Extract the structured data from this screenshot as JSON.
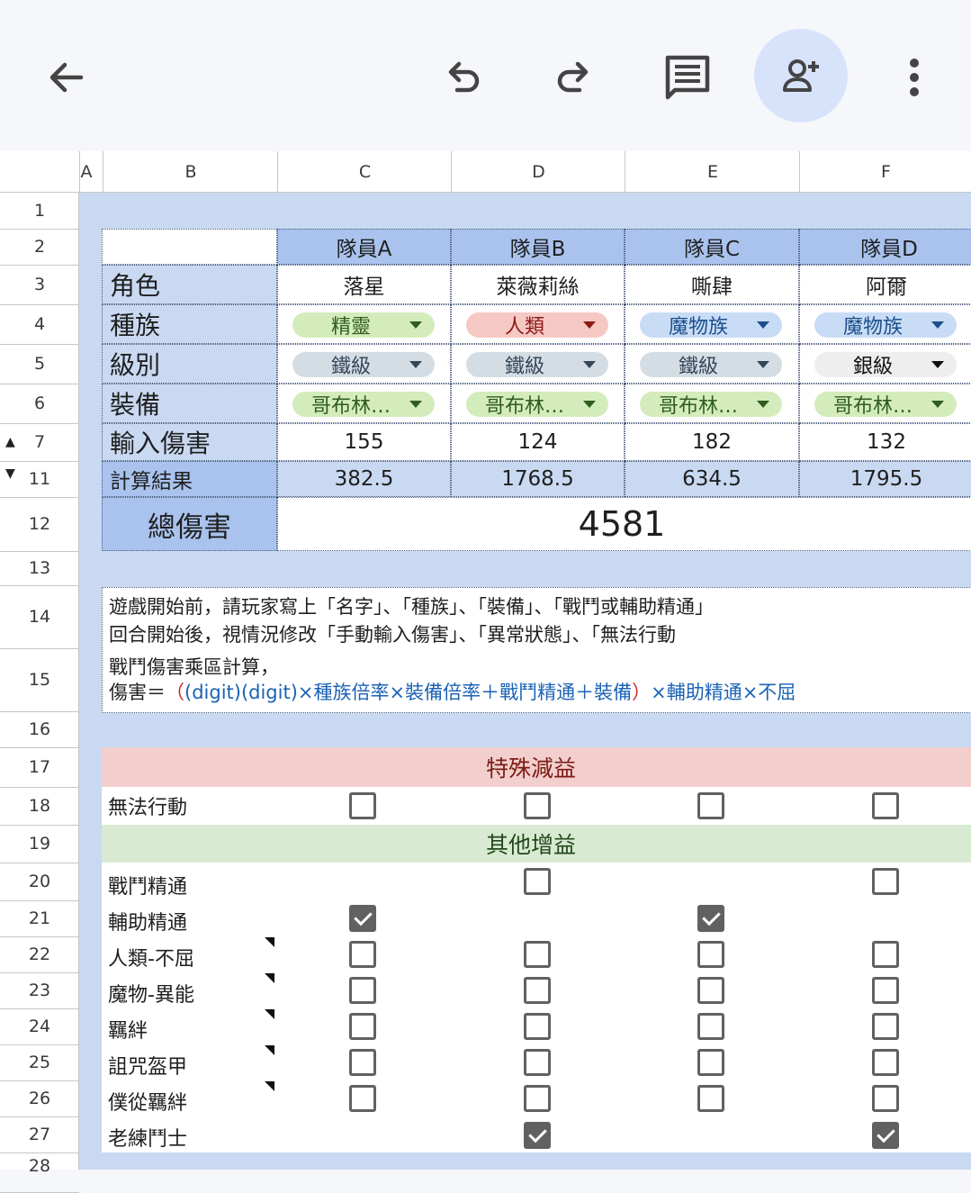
{
  "columns": [
    "A",
    "B",
    "C",
    "D",
    "E",
    "F"
  ],
  "rows": [
    "1",
    "2",
    "3",
    "4",
    "5",
    "6",
    "7",
    "11",
    "12",
    "13",
    "14",
    "15",
    "16",
    "17",
    "18",
    "19",
    "20",
    "21",
    "22",
    "23",
    "24",
    "25",
    "26",
    "27",
    "28"
  ],
  "members": [
    "隊員A",
    "隊員B",
    "隊員C",
    "隊員D"
  ],
  "labels": {
    "role": "角色",
    "race": "種族",
    "level": "級別",
    "equip": "裝備",
    "input_damage": "輸入傷害",
    "calc_result": "計算結果",
    "total_damage": "總傷害"
  },
  "roles": [
    "落星",
    "萊薇莉絲",
    "嘶肆",
    "阿爾"
  ],
  "races": [
    {
      "label": "精靈",
      "color": "#d4ecbc"
    },
    {
      "label": "人類",
      "color": "#f6c8c4"
    },
    {
      "label": "魔物族",
      "color": "#c8dcf6"
    },
    {
      "label": "魔物族",
      "color": "#c8dcf6"
    }
  ],
  "levels": [
    "鐵級",
    "鐵級",
    "鐵級",
    "銀級"
  ],
  "equips": [
    "哥布林…",
    "哥布林…",
    "哥布林…",
    "哥布林…"
  ],
  "input_damage": [
    "155",
    "124",
    "182",
    "132"
  ],
  "calc_results": [
    "382.5",
    "1768.5",
    "634.5",
    "1795.5"
  ],
  "total": "4581",
  "notes": {
    "line1": "遊戲開始前，請玩家寫上「名字」、「種族」、「裝備」、「戰鬥或輔助精通」",
    "line2": "回合開始後，視情況修改「手動輸入傷害」、「異常狀態」、「無法行動",
    "line3": "戰鬥傷害乘區計算，",
    "formula_prefix": "傷害＝",
    "formula_open": "（",
    "formula_body": "(digit)(digit)×種族倍率×裝備倍率＋戰鬥精通＋裝備",
    "formula_close": "）",
    "formula_suffix": "×輔助精通×不屈"
  },
  "sections": {
    "debuff": "特殊減益",
    "buff": "其他增益"
  },
  "checks": [
    {
      "label": "無法行動",
      "note": false,
      "states": [
        false,
        false,
        false,
        false
      ]
    },
    {
      "label": "戰鬥精通",
      "note": false,
      "states": [
        null,
        false,
        null,
        false
      ]
    },
    {
      "label": "輔助精通",
      "note": false,
      "states": [
        true,
        null,
        true,
        null
      ]
    },
    {
      "label": "人類-不屈",
      "note": true,
      "states": [
        false,
        false,
        false,
        false
      ]
    },
    {
      "label": "魔物-異能",
      "note": true,
      "states": [
        false,
        false,
        false,
        false
      ]
    },
    {
      "label": "羈絆",
      "note": true,
      "states": [
        false,
        false,
        false,
        false
      ]
    },
    {
      "label": "詛咒盔甲",
      "note": true,
      "states": [
        false,
        false,
        false,
        false
      ]
    },
    {
      "label": "僕從羈絆",
      "note": true,
      "states": [
        false,
        false,
        false,
        false
      ]
    },
    {
      "label": "老練鬥士",
      "note": false,
      "states": [
        null,
        true,
        null,
        true
      ]
    }
  ],
  "colors": {
    "accent": "#d6e3fb",
    "debuff_bg": "#f2cfcd",
    "buff_bg": "#d9ead3",
    "sheet_bg": "#c9d9f2"
  }
}
